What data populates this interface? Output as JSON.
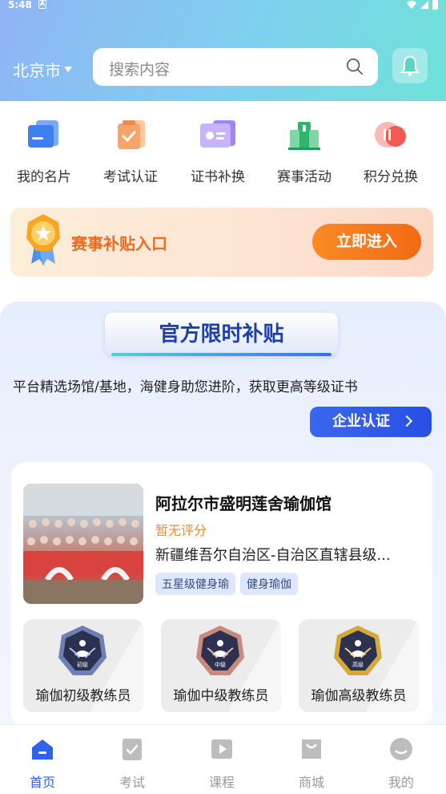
{
  "status_bar": {
    "time": "5:48"
  },
  "header": {
    "city": "北京市",
    "search_placeholder": "搜索内容"
  },
  "quick_menu": [
    {
      "label": "我的名片",
      "icon": "card-icon"
    },
    {
      "label": "考试认证",
      "icon": "exam-icon"
    },
    {
      "label": "证书补换",
      "icon": "certificate-icon"
    },
    {
      "label": "赛事活动",
      "icon": "podium-icon"
    },
    {
      "label": "积分兑换",
      "icon": "points-icon"
    }
  ],
  "banner": {
    "title": "赛事补贴入口",
    "button": "立即进入"
  },
  "official": {
    "title": "官方限时补贴",
    "description": "平台精选场馆/基地，海健身助您进阶，获取更高等级证书",
    "enterprise_button": "企业认证"
  },
  "venue": {
    "name": "阿拉尔市盛明莲舍瑜伽馆",
    "rating": "暂无评分",
    "address": "新疆维吾尔自治区-自治区直辖县级...",
    "tags": [
      "五星级健身瑜",
      "健身瑜伽"
    ],
    "certs": [
      {
        "label": "瑜伽初级教练员",
        "level": "初级",
        "color": "#6f7fb3"
      },
      {
        "label": "瑜伽中级教练员",
        "level": "中级",
        "color": "#c98a7c"
      },
      {
        "label": "瑜伽高级教练员",
        "level": "高级",
        "color": "#d4a93c"
      }
    ]
  },
  "tabs": [
    {
      "label": "首页",
      "active": true
    },
    {
      "label": "考试",
      "active": false
    },
    {
      "label": "课程",
      "active": false
    },
    {
      "label": "商城",
      "active": false
    },
    {
      "label": "我的",
      "active": false
    }
  ],
  "colors": {
    "accent": "#2d62e9",
    "orange": "#f46a12",
    "rating": "#ef8c2f"
  }
}
